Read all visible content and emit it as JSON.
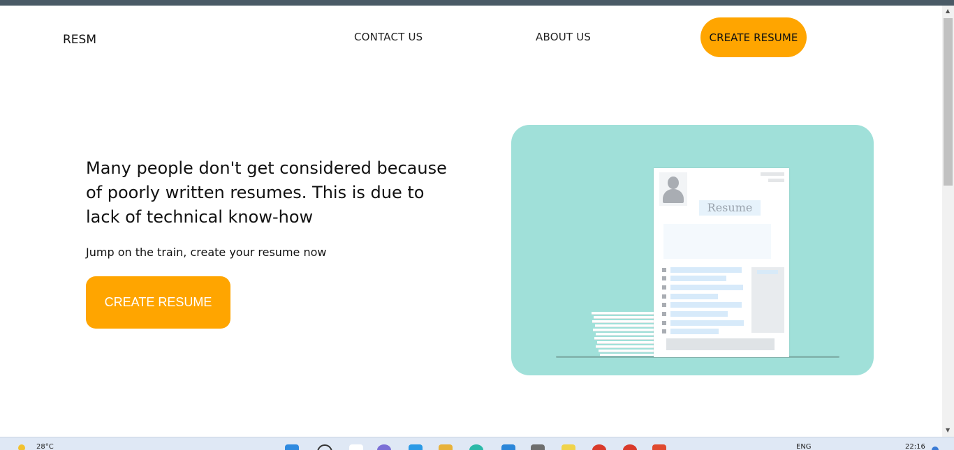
{
  "nav": {
    "logo": "RESM",
    "contact": "CONTACT US",
    "about": "ABOUT US",
    "cta": "CREATE RESUME"
  },
  "hero": {
    "headline": "Many people don't get considered because of poorly written resumes. This is due to lack of technical know-how",
    "subtext": "Jump on the train, create your resume now",
    "cta": "CREATE RESUME"
  },
  "illustration": {
    "doc_title": "Resume"
  },
  "taskbar": {
    "temperature": "28°C",
    "language": "ENG",
    "time": "22:16"
  },
  "colors": {
    "accent": "#ffa500",
    "illustration_bg": "#a0e0d9",
    "top_strip": "#4a5a66"
  }
}
